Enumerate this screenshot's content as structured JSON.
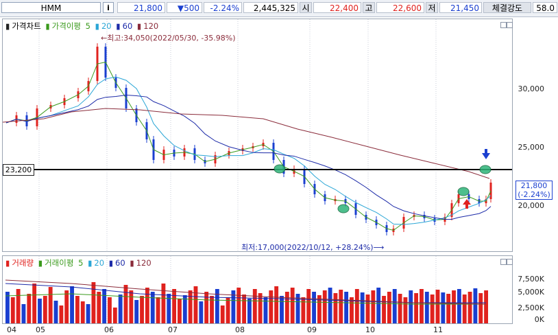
{
  "topbar": {
    "ticker": "HMM",
    "info_button": "i",
    "price": "21,800",
    "change": "▼500",
    "change_pct": "-2.24%",
    "volume": "2,445,325",
    "open_label": "시",
    "open": "22,400",
    "high_label": "고",
    "high": "22,600",
    "low_label": "저",
    "low": "21,450",
    "strength_label": "체결강도",
    "strength": "58.0"
  },
  "colors": {
    "up": "#e0221e",
    "down": "#1a3fd0",
    "ma5": "#3a9a1c",
    "ma20": "#2aa6d6",
    "ma60": "#1c2aa8",
    "ma120": "#8a2b3a",
    "hline": "#000000",
    "oval": "#2fb57a"
  },
  "price_pane": {
    "legend": {
      "title": "가격차트",
      "ma_title": "가격이평",
      "ma5": "5",
      "ma20": "20",
      "ma60": "60",
      "ma120": "120"
    },
    "high_annotation": "←최고:34,050(2022/05/30, -35.98%)",
    "low_annotation": "최저:17,000(2022/10/12, +28.24%)⟶",
    "horizontal_line_label": "23,200",
    "current_price_label": "21,800",
    "current_change_label": "(-2.24%)",
    "y_ticks": [
      "30,000",
      "25,000",
      "20,000"
    ],
    "icons": {
      "down_arrow": "blue-down-arrow-icon",
      "up_arrow": "red-up-arrow-icon"
    }
  },
  "volume_pane": {
    "legend": {
      "title": "거래량",
      "ma_title": "거래이평",
      "ma5": "5",
      "ma20": "20",
      "ma60": "60",
      "ma120": "120"
    },
    "y_ticks": [
      "7,500K",
      "5,000K",
      "2,500K",
      "0K"
    ]
  },
  "x_labels": [
    "04",
    "05",
    "06",
    "07",
    "08",
    "09",
    "10",
    "11"
  ]
}
